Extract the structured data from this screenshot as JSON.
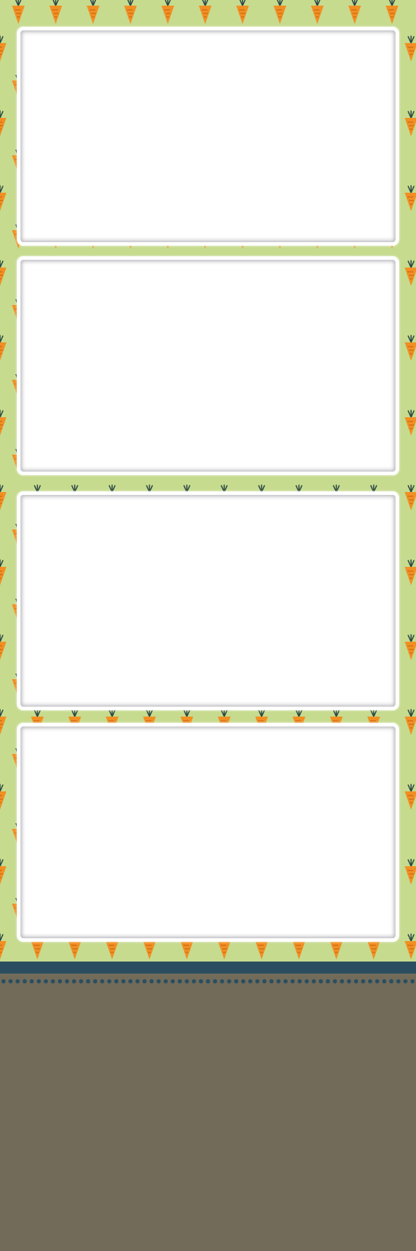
{
  "template": {
    "pattern": "carrot-icon",
    "colors": {
      "background_green": "#c6db8e",
      "carrot_orange": "#f28f22",
      "carrot_stripe": "#c8661a",
      "leaf_dark": "#2e4a44",
      "band_navy": "#2a4e60",
      "footer_taupe": "#726b5a",
      "frame_white": "#ffffff"
    },
    "photo_slots": [
      {
        "caption": ""
      },
      {
        "caption": ""
      },
      {
        "caption": ""
      },
      {
        "caption": ""
      }
    ],
    "footer_text": ""
  }
}
